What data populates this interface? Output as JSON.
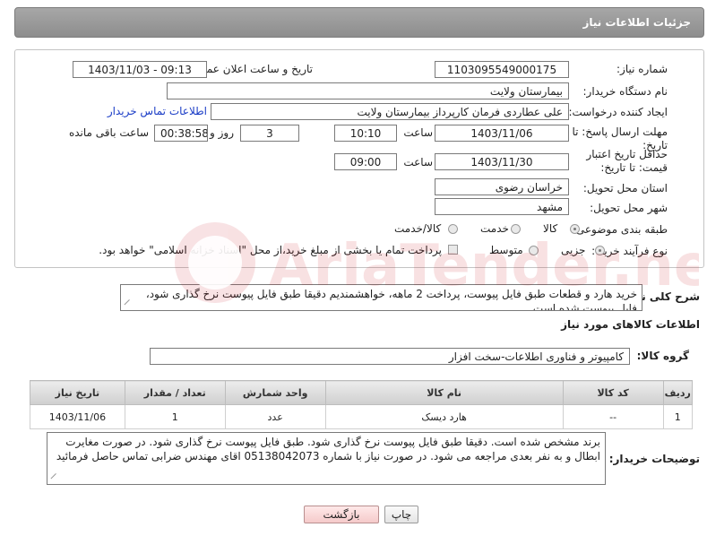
{
  "header": {
    "title": "جزئیات اطلاعات نیاز"
  },
  "form": {
    "need_number_label": "شماره نیاز:",
    "need_number": "1103095549000175",
    "announce_label": "تاریخ و ساعت اعلان عمومی:",
    "announce_value": "1403/11/03 - 09:13",
    "buyer_org_label": "نام دستگاه خریدار:",
    "buyer_org": "بیمارستان ولایت",
    "creator_label": "ایجاد کننده درخواست:",
    "creator": "علی عطاردی فرمان کارپرداز بیمارستان ولایت",
    "contact_link": "اطلاعات تماس خریدار",
    "deadline_label": "مهلت ارسال پاسخ: تا تاریخ:",
    "deadline_date": "1403/11/06",
    "hour_label": "ساعت",
    "deadline_time": "10:10",
    "days_value": "3",
    "days_label": "روز و",
    "remaining_time": "00:38:58",
    "remaining_label": "ساعت باقی مانده",
    "validity_label": "حداقل تاریخ اعتبار قیمت: تا تاریخ:",
    "validity_date": "1403/11/30",
    "validity_time": "09:00",
    "province_label": "استان محل تحویل:",
    "province": "خراسان رضوی",
    "city_label": "شهر محل تحویل:",
    "city": "مشهد",
    "category_label": "طبقه بندی موضوعی:",
    "category_options": [
      "کالا",
      "خدمت",
      "کالا/خدمت"
    ],
    "purchase_label": "نوع فرآیند خرید :",
    "purchase_options": [
      "جزیی",
      "متوسط"
    ],
    "treasury_text": "پرداخت تمام یا بخشی از مبلغ خرید،از محل \"اسناد خزانه اسلامی\" خواهد بود."
  },
  "description": {
    "label": "شرح کلی نیاز:",
    "text": "خرید هارد و قطعات طبق فایل پیوست، پرداخت 2 ماهه، خواهشمندیم دقیقا طبق فایل پیوست نرخ گذاری شود، فایل پیوست شده است"
  },
  "goods": {
    "section_title": "اطلاعات کالاهای مورد نیاز",
    "group_label": "گروه کالا:",
    "group_value": "کامپیوتر و فناوری اطلاعات-سخت افزار",
    "columns": [
      "ردیف",
      "کد کالا",
      "نام کالا",
      "واحد شمارش",
      "تعداد / مقدار",
      "تاریخ نیاز"
    ],
    "rows": [
      [
        "1",
        "--",
        "هارد دیسک",
        "عدد",
        "1",
        "1403/11/06"
      ]
    ]
  },
  "buyer_notes": {
    "label": "توضیحات خریدار:",
    "text": "برند مشخص شده است. دقیقا طبق فایل پیوست نرخ گذاری شود. طبق فایل پیوست نرخ گذاری شود. در صورت مغایرت ابطال و به نفر بعدی مراجعه می شود. در صورت نیاز با شماره 05138042073 اقای مهندس ضرابی تماس حاصل فرمائید"
  },
  "buttons": {
    "print": "چاپ",
    "back": "بازگشت"
  },
  "watermark": {
    "text": "AriaTender.neT"
  },
  "colors": {
    "link": "#1a3cc6",
    "header": "#999999",
    "back_button": "#f5caca"
  }
}
